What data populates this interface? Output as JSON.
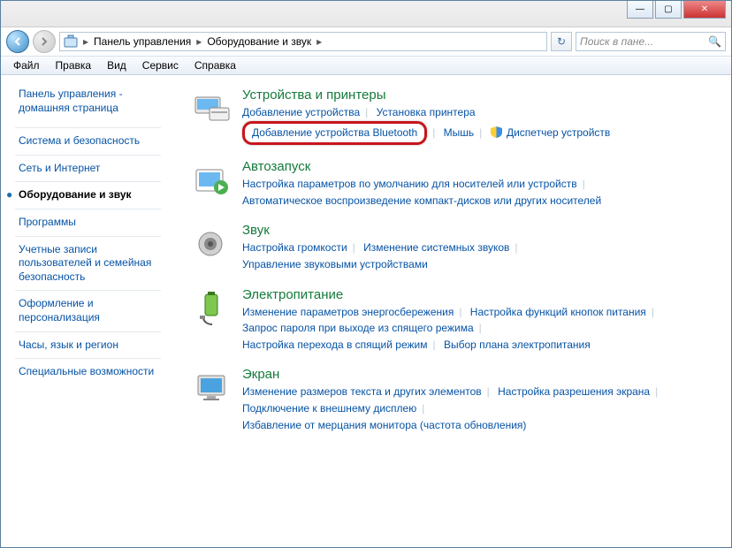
{
  "titlebar": {
    "min": "—",
    "max": "▢",
    "close": "✕"
  },
  "address": {
    "crumb1": "Панель управления",
    "crumb2": "Оборудование и звук",
    "arrow": "▸",
    "refresh": "↻",
    "search_placeholder": "Поиск в пане...",
    "search_icon": "🔍"
  },
  "menu": {
    "file": "Файл",
    "edit": "Правка",
    "view": "Вид",
    "service": "Сервис",
    "help": "Справка"
  },
  "sidebar": {
    "home1": "Панель управления -",
    "home2": "домашняя страница",
    "sys": "Система и безопасность",
    "net": "Сеть и Интернет",
    "hw": "Оборудование и звук",
    "prog": "Программы",
    "users1": "Учетные записи",
    "users2": "пользователей и семейная",
    "users3": "безопасность",
    "appear1": "Оформление и",
    "appear2": "персонализация",
    "clock": "Часы, язык и регион",
    "access": "Специальные возможности"
  },
  "cat": {
    "devices": {
      "title": "Устройства и принтеры",
      "l1": "Добавление устройства",
      "l2": "Установка принтера",
      "l3": "Добавление устройства Bluetooth",
      "l4": "Мышь",
      "l5": "Диспетчер устройств"
    },
    "autoplay": {
      "title": "Автозапуск",
      "l1": "Настройка параметров по умолчанию для носителей или устройств",
      "l2": "Автоматическое воспроизведение компакт-дисков или других носителей"
    },
    "sound": {
      "title": "Звук",
      "l1": "Настройка громкости",
      "l2": "Изменение системных звуков",
      "l3": "Управление звуковыми устройствами"
    },
    "power": {
      "title": "Электропитание",
      "l1": "Изменение параметров энергосбережения",
      "l2": "Настройка функций кнопок питания",
      "l3": "Запрос пароля при выходе из спящего режима",
      "l4": "Настройка перехода в спящий режим",
      "l5": "Выбор плана электропитания"
    },
    "display": {
      "title": "Экран",
      "l1": "Изменение размеров текста и других элементов",
      "l2": "Настройка разрешения экрана",
      "l3": "Подключение к внешнему дисплею",
      "l4": "Избавление от мерцания монитора (частота обновления)"
    }
  }
}
